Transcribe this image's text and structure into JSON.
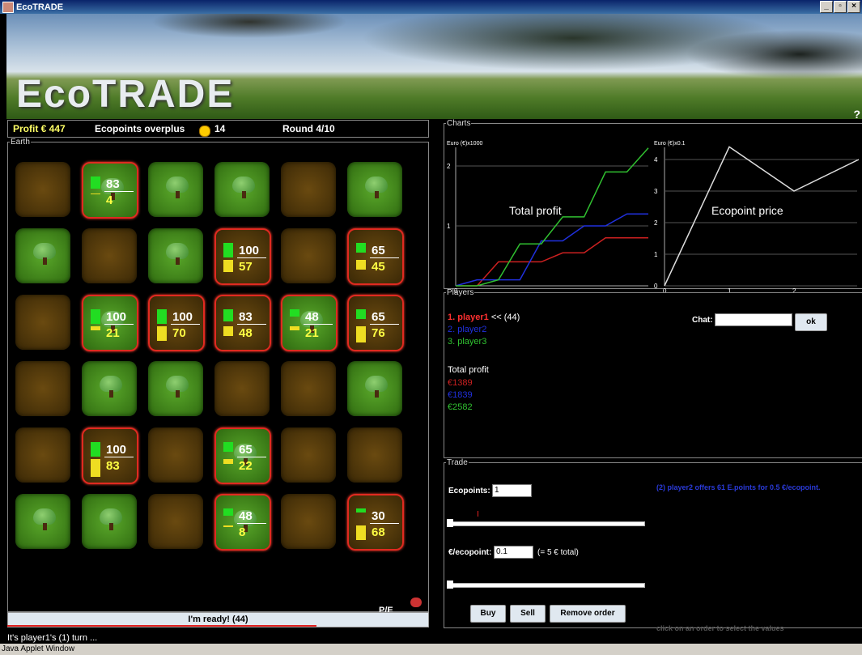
{
  "window": {
    "title": "EcoTRADE",
    "minimize": "_",
    "maximize": "b",
    "close": "×"
  },
  "banner": {
    "logo": "EcoTRADE",
    "help": "?"
  },
  "status": {
    "profit": "Profit € 447",
    "ecopoints_label": "Ecopoints overplus",
    "ecopoints_value": "14",
    "round": "Round 4/10"
  },
  "earth": {
    "legend": "Earth",
    "tiles": [
      [
        {
          "c": "brown"
        },
        {
          "c": "green",
          "red": true,
          "tree": true,
          "p": "83",
          "e": "4"
        },
        {
          "c": "green",
          "tree": true
        },
        {
          "c": "green",
          "tree": true
        },
        {
          "c": "brown"
        },
        {
          "c": "green",
          "tree": true
        }
      ],
      [
        {
          "c": "green",
          "tree": true
        },
        {
          "c": "brown"
        },
        {
          "c": "green",
          "tree": true
        },
        {
          "c": "brown",
          "red": true,
          "p": "100",
          "e": "57"
        },
        {
          "c": "brown"
        },
        {
          "c": "brown",
          "red": true,
          "p": "65",
          "e": "45"
        }
      ],
      [
        {
          "c": "brown"
        },
        {
          "c": "green",
          "red": true,
          "tree": true,
          "p": "100",
          "e": "21"
        },
        {
          "c": "brown",
          "red": true,
          "p": "100",
          "e": "70"
        },
        {
          "c": "brown",
          "red": true,
          "p": "83",
          "e": "48"
        },
        {
          "c": "green",
          "red": true,
          "tree": true,
          "p": "48",
          "e": "21"
        },
        {
          "c": "brown",
          "red": true,
          "p": "65",
          "e": "76"
        }
      ],
      [
        {
          "c": "brown"
        },
        {
          "c": "green",
          "tree": true
        },
        {
          "c": "green",
          "tree": true
        },
        {
          "c": "brown"
        },
        {
          "c": "brown"
        },
        {
          "c": "green",
          "tree": true
        }
      ],
      [
        {
          "c": "brown"
        },
        {
          "c": "brown",
          "red": true,
          "p": "100",
          "e": "83"
        },
        {
          "c": "brown"
        },
        {
          "c": "green",
          "red": true,
          "tree": true,
          "p": "65",
          "e": "22"
        },
        {
          "c": "brown"
        },
        {
          "c": "brown"
        }
      ],
      [
        {
          "c": "green",
          "tree": true
        },
        {
          "c": "green",
          "tree": true
        },
        {
          "c": "brown"
        },
        {
          "c": "green",
          "red": true,
          "tree": true,
          "p": "48",
          "e": "8"
        },
        {
          "c": "brown"
        },
        {
          "c": "brown",
          "red": true,
          "p": "30",
          "e": "68"
        }
      ]
    ],
    "pe_label": "P/E"
  },
  "ready_button": "I'm ready! (44)",
  "turn_status": "It's player1's (1) turn ...",
  "applet_window": "Java Applet Window",
  "charts": {
    "legend": "Charts",
    "profit_axis": "Euro (€)x1000",
    "profit_title": "Total profit",
    "price_axis": "Euro (€)x0.1",
    "price_title": "Ecopoint price"
  },
  "chart_data": [
    {
      "type": "line",
      "title": "Total profit",
      "ylabel": "Euro (€)x1000",
      "yticks": [
        "1",
        "2"
      ],
      "xticks": [
        "0"
      ],
      "series": [
        {
          "name": "player1",
          "color": "#cc2020",
          "values": [
            0,
            0,
            0.4,
            0.4,
            0.4,
            0.55,
            0.55,
            0.8,
            0.8,
            0.8
          ]
        },
        {
          "name": "player2",
          "color": "#2030dd",
          "values": [
            0,
            0.1,
            0.1,
            0.1,
            0.75,
            0.75,
            1.0,
            1.0,
            1.2,
            1.2
          ]
        },
        {
          "name": "player3",
          "color": "#30c030",
          "values": [
            0,
            0,
            0.1,
            0.7,
            0.7,
            1.15,
            1.15,
            1.9,
            1.9,
            2.3
          ]
        }
      ]
    },
    {
      "type": "line",
      "title": "Ecopoint price",
      "ylabel": "Euro (€)x0.1",
      "yticks": [
        "0",
        "1",
        "2",
        "3",
        "4"
      ],
      "xticks": [
        "0",
        "1",
        "2"
      ],
      "series": [
        {
          "color": "#dddddd",
          "x": [
            0,
            1,
            2,
            3
          ],
          "values": [
            0,
            4.4,
            3,
            4
          ]
        }
      ]
    }
  ],
  "players": {
    "legend": "Players",
    "list": [
      {
        "label": "1. player1",
        "suffix": "<< (44)",
        "color": "#ff3030"
      },
      {
        "label": "2. player2",
        "color": "#2030dd"
      },
      {
        "label": "3. player3",
        "color": "#30c030"
      }
    ],
    "total_profit_label": "Total profit",
    "profits": [
      {
        "value": "€1389",
        "color": "#cc2020"
      },
      {
        "value": "€1839",
        "color": "#2030dd"
      },
      {
        "value": "€2582",
        "color": "#30c030"
      }
    ],
    "chat_label": "Chat:",
    "chat_value": "",
    "ok": "ok"
  },
  "trade": {
    "legend": "Trade",
    "ecopoints_label": "Ecopoints:",
    "ecopoints_value": "1",
    "price_label": "€/ecopoint:",
    "price_value": "0.1",
    "total": "(= 5 € total)",
    "offer": "(2) player2 offers 61 E.points for 0.5 €/ecopoint.",
    "buy": "Buy",
    "sell": "Sell",
    "remove": "Remove order",
    "hint": "click on an order to select the values"
  }
}
